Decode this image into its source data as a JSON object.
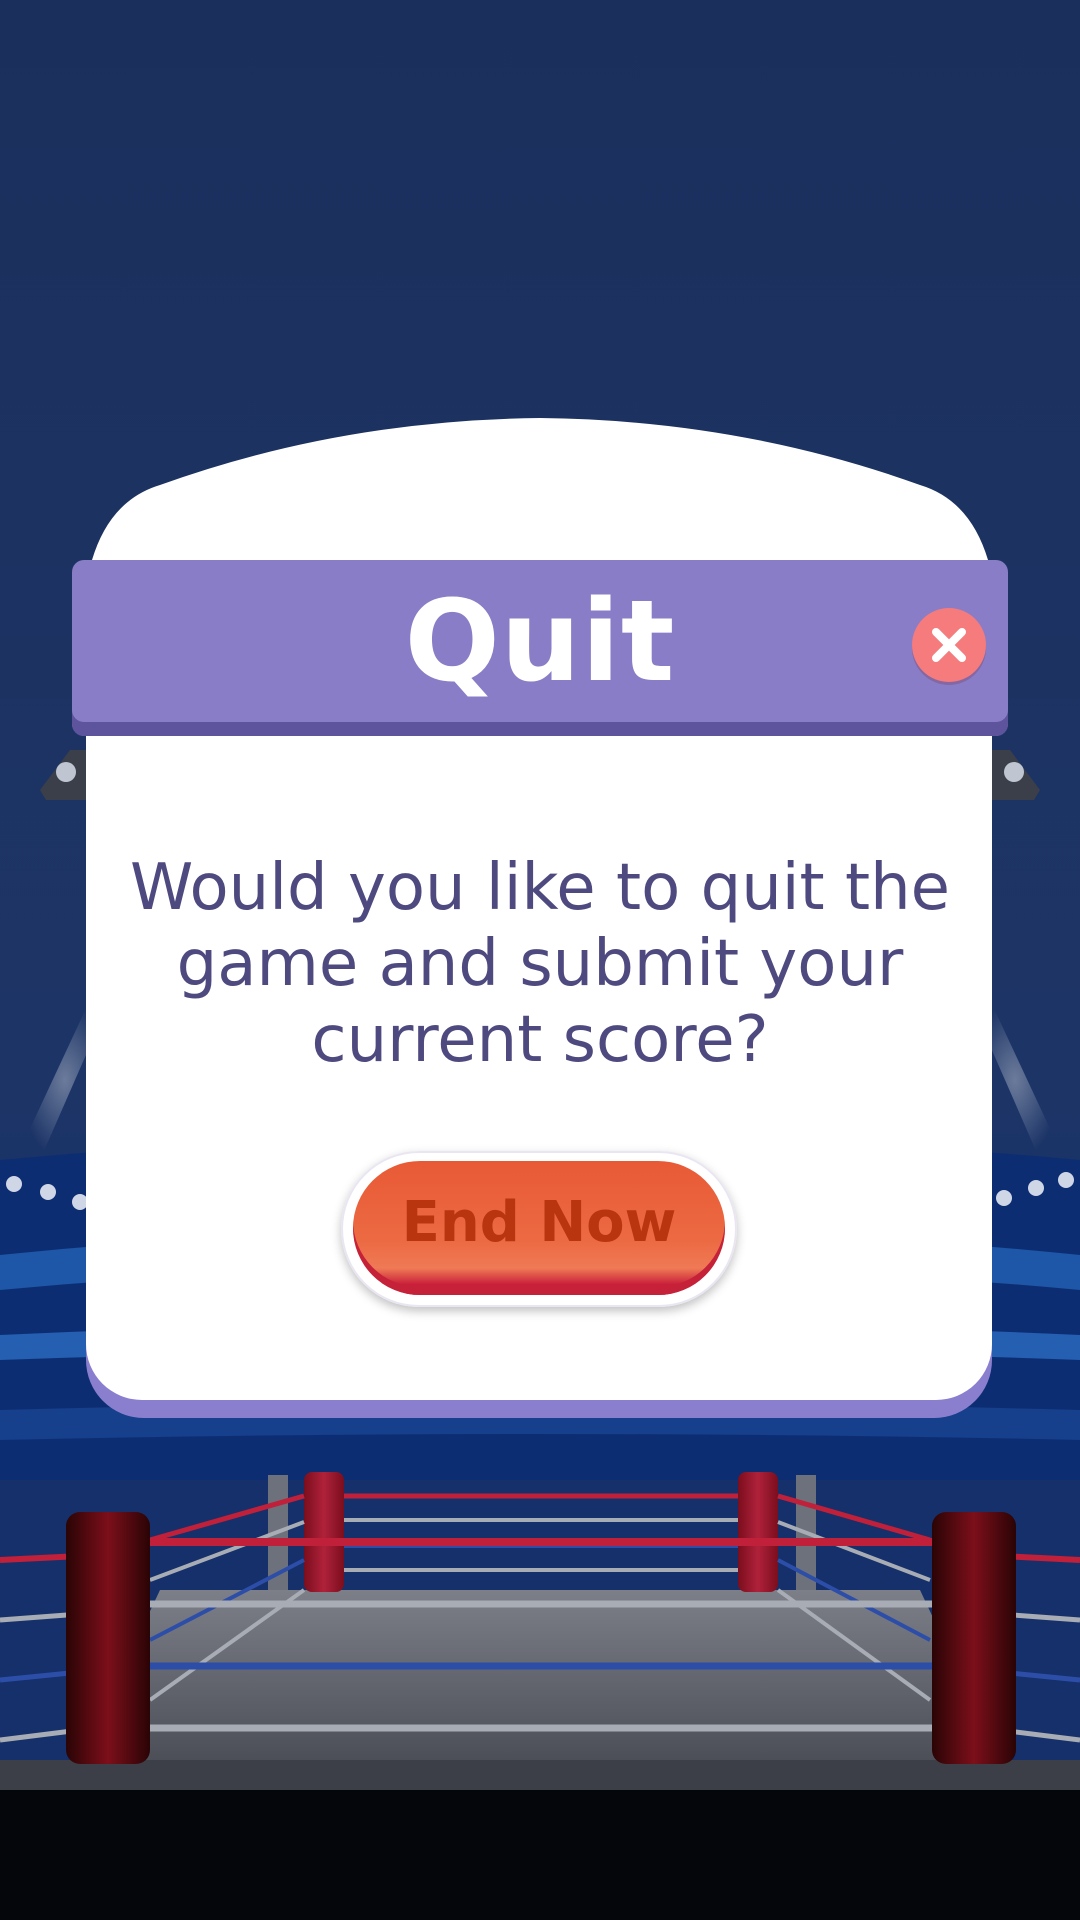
{
  "dialog": {
    "title": "Quit",
    "message": "Would you like to quit the game and submit your current score?",
    "primary_button": "End Now",
    "close_icon": "close-icon"
  },
  "colors": {
    "background": "#1b2f5c",
    "header": "#887dc6",
    "close_button": "#f57b7c",
    "message_text": "#4e4a7f",
    "button": "#e85a35",
    "button_text": "#b83510"
  },
  "icons": [
    "close-icon",
    "spotlight-icon",
    "boxing-ring-icon"
  ]
}
